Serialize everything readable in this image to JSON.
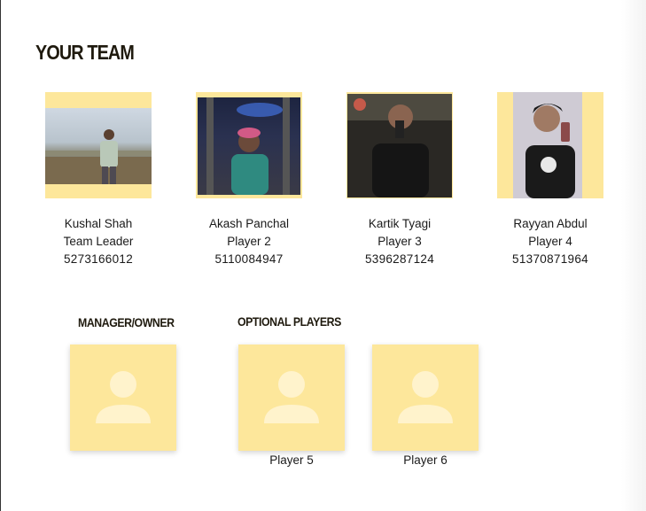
{
  "section_title": "YOUR TEAM",
  "players": [
    {
      "name": "Kushal Shah",
      "role": "Team Leader",
      "phone": "5273166012"
    },
    {
      "name": "Akash Panchal",
      "role": "Player 2",
      "phone": "5110084947"
    },
    {
      "name": "Kartik Tyagi",
      "role": "Player 3",
      "phone": "5396287124"
    },
    {
      "name": "Rayyan Abdul",
      "role": "Player 4",
      "phone": "51370871964"
    }
  ],
  "manager": {
    "title": "MANAGER/OWNER"
  },
  "optional": {
    "title": "OPTIONAL PLAYERS",
    "slots": [
      {
        "label": "Player 5"
      },
      {
        "label": "Player 6"
      }
    ]
  },
  "colors": {
    "tile": "#fde79b",
    "placeholder_icon": "#fff3cc",
    "heading": "#1f1a0e"
  }
}
